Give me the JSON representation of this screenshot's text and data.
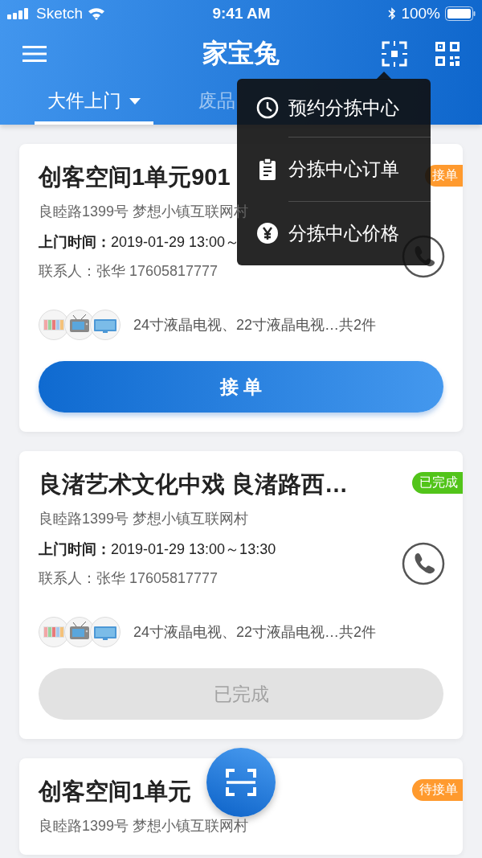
{
  "status_bar": {
    "carrier": "Sketch",
    "time": "9:41 AM",
    "battery": "100%"
  },
  "nav": {
    "title": "家宝兔"
  },
  "tabs": [
    {
      "label": "大件上门",
      "selected": true,
      "caret": true
    },
    {
      "label": "废品",
      "selected": false,
      "caret": false
    }
  ],
  "orders": [
    {
      "title": "创客空间1单元901",
      "address": "良睦路1399号 梦想小镇互联网村",
      "time_label": "上门时间：",
      "time": "2019-01-29 13:00～",
      "contact": "联系人：张华 17605817777",
      "items": "24寸液晶电视、22寸液晶电视…共2件",
      "status": {
        "kind": "pending",
        "label": "接单"
      },
      "button": {
        "label": "接 单",
        "disabled": false
      }
    },
    {
      "title": "良渚艺术文化中戏 良渚路西…",
      "address": "良睦路1399号 梦想小镇互联网村",
      "time_label": "上门时间：",
      "time": "2019-01-29 13:00～13:30",
      "contact": "联系人：张华 17605817777",
      "items": "24寸液晶电视、22寸液晶电视…共2件",
      "status": {
        "kind": "done",
        "label": "已完成"
      },
      "button": {
        "label": "已完成",
        "disabled": true
      }
    },
    {
      "title": "创客空间1单元",
      "address": "良睦路1399号 梦想小镇互联网村",
      "status": {
        "kind": "pending",
        "label": "待接单"
      }
    }
  ],
  "menu": {
    "items": [
      {
        "kind": "clock",
        "label": "预约分拣中心"
      },
      {
        "kind": "clipboard",
        "label": "分拣中心订单"
      },
      {
        "kind": "yen",
        "label": "分拣中心价格"
      }
    ]
  }
}
